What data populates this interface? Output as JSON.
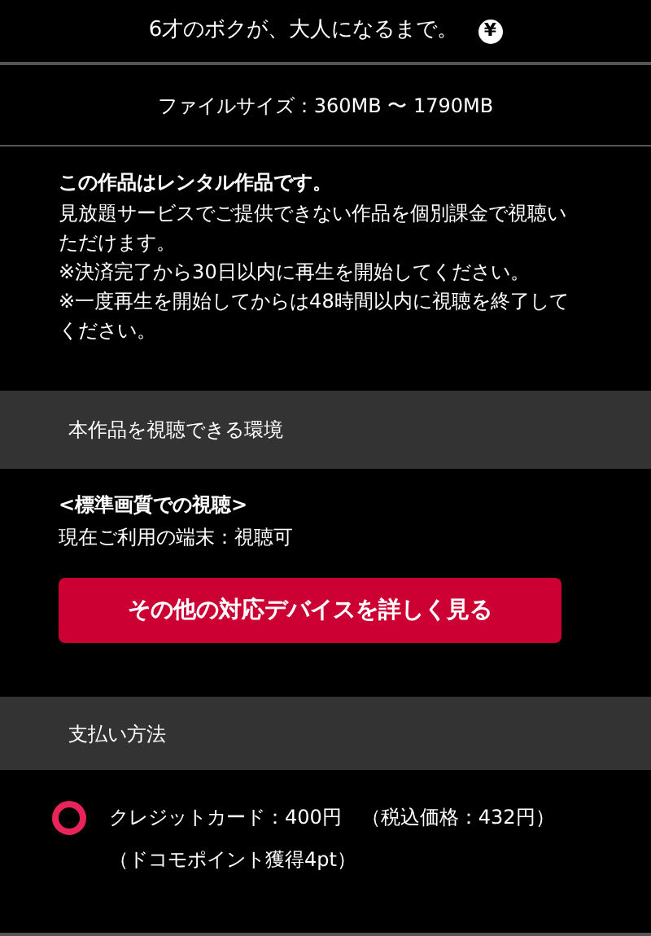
{
  "title": {
    "text": "6才のボクが、大人になるまで。",
    "badge": "¥"
  },
  "file_size": "ファイルサイズ：360MB 〜 1790MB",
  "notice": {
    "heading": "この作品はレンタル作品です。",
    "lines": [
      "見放題サービスでご提供できない作品を個別課金で視聴いただけます。",
      "※決済完了から30日以内に再生を開始してください。",
      "※一度再生を開始してからは48時間以内に視聴を終了してください。"
    ]
  },
  "environment": {
    "header": "本作品を視聴できる環境",
    "quality": "<標準画質での視聴>",
    "status": "現在ご利用の端末：視聴可",
    "button": "その他の対応デバイスを詳しく見る"
  },
  "payment": {
    "header": "支払い方法",
    "options": [
      {
        "label": "クレジットカード：400円　（税込価格：432円）",
        "note": "（ドコモポイント獲得4pt）",
        "selected": false
      }
    ]
  }
}
